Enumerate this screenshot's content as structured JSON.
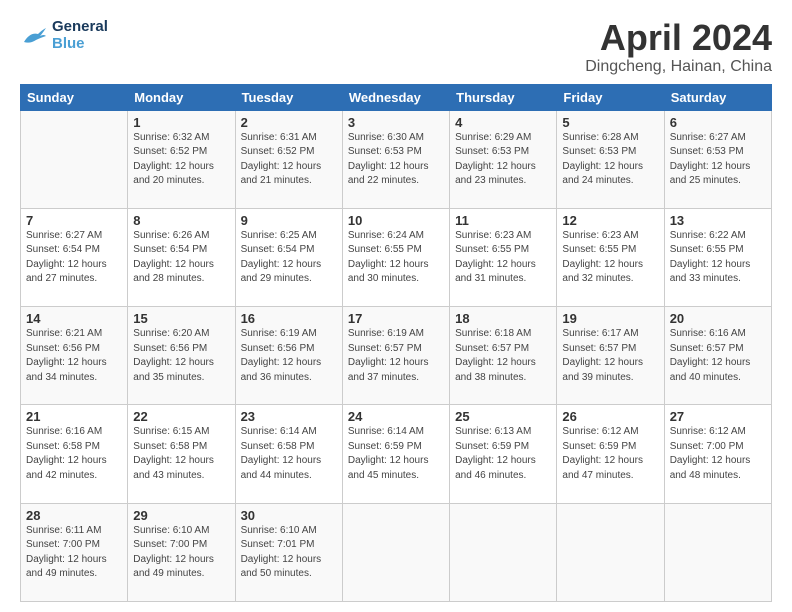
{
  "header": {
    "logo_line1": "General",
    "logo_line2": "Blue",
    "title": "April 2024",
    "subtitle": "Dingcheng, Hainan, China"
  },
  "calendar": {
    "headers": [
      "Sunday",
      "Monday",
      "Tuesday",
      "Wednesday",
      "Thursday",
      "Friday",
      "Saturday"
    ],
    "weeks": [
      [
        {
          "num": "",
          "info": ""
        },
        {
          "num": "1",
          "info": "Sunrise: 6:32 AM\nSunset: 6:52 PM\nDaylight: 12 hours\nand 20 minutes."
        },
        {
          "num": "2",
          "info": "Sunrise: 6:31 AM\nSunset: 6:52 PM\nDaylight: 12 hours\nand 21 minutes."
        },
        {
          "num": "3",
          "info": "Sunrise: 6:30 AM\nSunset: 6:53 PM\nDaylight: 12 hours\nand 22 minutes."
        },
        {
          "num": "4",
          "info": "Sunrise: 6:29 AM\nSunset: 6:53 PM\nDaylight: 12 hours\nand 23 minutes."
        },
        {
          "num": "5",
          "info": "Sunrise: 6:28 AM\nSunset: 6:53 PM\nDaylight: 12 hours\nand 24 minutes."
        },
        {
          "num": "6",
          "info": "Sunrise: 6:27 AM\nSunset: 6:53 PM\nDaylight: 12 hours\nand 25 minutes."
        }
      ],
      [
        {
          "num": "7",
          "info": "Sunrise: 6:27 AM\nSunset: 6:54 PM\nDaylight: 12 hours\nand 27 minutes."
        },
        {
          "num": "8",
          "info": "Sunrise: 6:26 AM\nSunset: 6:54 PM\nDaylight: 12 hours\nand 28 minutes."
        },
        {
          "num": "9",
          "info": "Sunrise: 6:25 AM\nSunset: 6:54 PM\nDaylight: 12 hours\nand 29 minutes."
        },
        {
          "num": "10",
          "info": "Sunrise: 6:24 AM\nSunset: 6:55 PM\nDaylight: 12 hours\nand 30 minutes."
        },
        {
          "num": "11",
          "info": "Sunrise: 6:23 AM\nSunset: 6:55 PM\nDaylight: 12 hours\nand 31 minutes."
        },
        {
          "num": "12",
          "info": "Sunrise: 6:23 AM\nSunset: 6:55 PM\nDaylight: 12 hours\nand 32 minutes."
        },
        {
          "num": "13",
          "info": "Sunrise: 6:22 AM\nSunset: 6:55 PM\nDaylight: 12 hours\nand 33 minutes."
        }
      ],
      [
        {
          "num": "14",
          "info": "Sunrise: 6:21 AM\nSunset: 6:56 PM\nDaylight: 12 hours\nand 34 minutes."
        },
        {
          "num": "15",
          "info": "Sunrise: 6:20 AM\nSunset: 6:56 PM\nDaylight: 12 hours\nand 35 minutes."
        },
        {
          "num": "16",
          "info": "Sunrise: 6:19 AM\nSunset: 6:56 PM\nDaylight: 12 hours\nand 36 minutes."
        },
        {
          "num": "17",
          "info": "Sunrise: 6:19 AM\nSunset: 6:57 PM\nDaylight: 12 hours\nand 37 minutes."
        },
        {
          "num": "18",
          "info": "Sunrise: 6:18 AM\nSunset: 6:57 PM\nDaylight: 12 hours\nand 38 minutes."
        },
        {
          "num": "19",
          "info": "Sunrise: 6:17 AM\nSunset: 6:57 PM\nDaylight: 12 hours\nand 39 minutes."
        },
        {
          "num": "20",
          "info": "Sunrise: 6:16 AM\nSunset: 6:57 PM\nDaylight: 12 hours\nand 40 minutes."
        }
      ],
      [
        {
          "num": "21",
          "info": "Sunrise: 6:16 AM\nSunset: 6:58 PM\nDaylight: 12 hours\nand 42 minutes."
        },
        {
          "num": "22",
          "info": "Sunrise: 6:15 AM\nSunset: 6:58 PM\nDaylight: 12 hours\nand 43 minutes."
        },
        {
          "num": "23",
          "info": "Sunrise: 6:14 AM\nSunset: 6:58 PM\nDaylight: 12 hours\nand 44 minutes."
        },
        {
          "num": "24",
          "info": "Sunrise: 6:14 AM\nSunset: 6:59 PM\nDaylight: 12 hours\nand 45 minutes."
        },
        {
          "num": "25",
          "info": "Sunrise: 6:13 AM\nSunset: 6:59 PM\nDaylight: 12 hours\nand 46 minutes."
        },
        {
          "num": "26",
          "info": "Sunrise: 6:12 AM\nSunset: 6:59 PM\nDaylight: 12 hours\nand 47 minutes."
        },
        {
          "num": "27",
          "info": "Sunrise: 6:12 AM\nSunset: 7:00 PM\nDaylight: 12 hours\nand 48 minutes."
        }
      ],
      [
        {
          "num": "28",
          "info": "Sunrise: 6:11 AM\nSunset: 7:00 PM\nDaylight: 12 hours\nand 49 minutes."
        },
        {
          "num": "29",
          "info": "Sunrise: 6:10 AM\nSunset: 7:00 PM\nDaylight: 12 hours\nand 49 minutes."
        },
        {
          "num": "30",
          "info": "Sunrise: 6:10 AM\nSunset: 7:01 PM\nDaylight: 12 hours\nand 50 minutes."
        },
        {
          "num": "",
          "info": ""
        },
        {
          "num": "",
          "info": ""
        },
        {
          "num": "",
          "info": ""
        },
        {
          "num": "",
          "info": ""
        }
      ]
    ]
  }
}
